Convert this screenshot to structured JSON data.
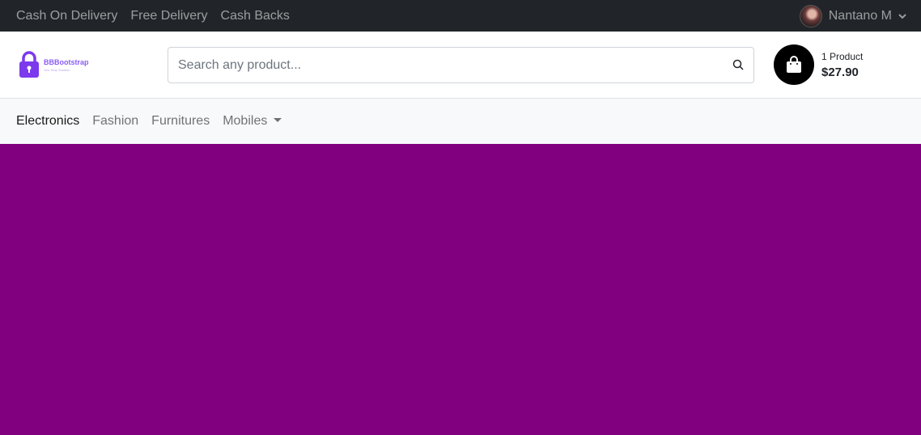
{
  "topbar": {
    "links": [
      "Cash On Delivery",
      "Free Delivery",
      "Cash Backs"
    ],
    "user_name": "Nantano M"
  },
  "header": {
    "logo_name": "BBBootstrap",
    "logo_tagline": "One Stop Solution",
    "search_placeholder": "Search any product...",
    "cart_count": "1 Product",
    "cart_price": "$27.90"
  },
  "nav": {
    "items": [
      "Electronics",
      "Fashion",
      "Furnitures",
      "Mobiles"
    ]
  },
  "colors": {
    "topbar_bg": "#212529",
    "hero_bg": "#800080",
    "logo_accent": "#7c3aed"
  }
}
